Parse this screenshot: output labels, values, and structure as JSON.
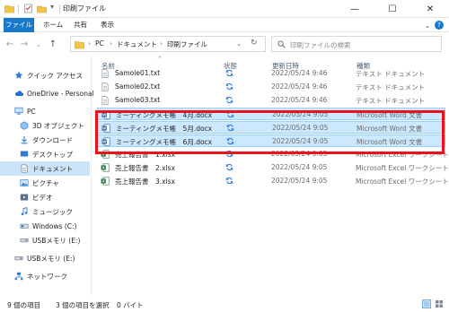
{
  "window": {
    "title": "印刷ファイル",
    "minimize": "—",
    "maximize": "☐",
    "close": "✕"
  },
  "ribbon": {
    "tabs": [
      "ファイル",
      "ホーム",
      "共有",
      "表示"
    ],
    "collapse": "⌄",
    "help": "?"
  },
  "address": {
    "back": "←",
    "forward": "→",
    "recent": "⌄",
    "up": "↑",
    "path": [
      "PC",
      "ドキュメント",
      "印刷ファイル"
    ],
    "separator": "›",
    "dropdown": "⌄",
    "refresh": "↻"
  },
  "search": {
    "placeholder": "印刷ファイルの検索"
  },
  "nav": {
    "items": [
      {
        "label": "クイック アクセス",
        "icon": "star-icon"
      },
      {
        "label": "OneDrive - Personal",
        "icon": "cloud-icon"
      },
      {
        "label": "PC",
        "icon": "computer-icon"
      },
      {
        "label": "3D オブジェクト",
        "icon": "3d-objects-icon"
      },
      {
        "label": "ダウンロード",
        "icon": "download-icon"
      },
      {
        "label": "デスクトップ",
        "icon": "desktop-icon"
      },
      {
        "label": "ドキュメント",
        "icon": "documents-icon"
      },
      {
        "label": "ピクチャ",
        "icon": "pictures-icon"
      },
      {
        "label": "ビデオ",
        "icon": "videos-icon"
      },
      {
        "label": "ミュージック",
        "icon": "music-icon"
      },
      {
        "label": "Windows (C:)",
        "icon": "drive-icon"
      },
      {
        "label": "USBメモリ (E:)",
        "icon": "usb-drive-icon"
      },
      {
        "label": "USBメモリ (E:)",
        "icon": "usb-drive-icon"
      },
      {
        "label": "ネットワーク",
        "icon": "network-icon"
      }
    ]
  },
  "columns": {
    "name": "名前",
    "status": "状態",
    "date": "更新日時",
    "type": "種類"
  },
  "files": [
    {
      "name": "Samole01.txt",
      "status": "sync",
      "date": "2022/05/24 9:46",
      "type": "テキスト ドキュメント",
      "kind": "txt",
      "selected": false
    },
    {
      "name": "Samole02.txt",
      "status": "sync",
      "date": "2022/05/24 9:46",
      "type": "テキスト ドキュメント",
      "kind": "txt",
      "selected": false
    },
    {
      "name": "Samole03.txt",
      "status": "sync",
      "date": "2022/05/24 9:46",
      "type": "テキスト ドキュメント",
      "kind": "txt",
      "selected": false
    },
    {
      "name": "ミーティングメモ帳　4月.docx",
      "status": "sync",
      "date": "2022/05/24 9:05",
      "type": "Microsoft Word 文書",
      "kind": "word",
      "selected": true
    },
    {
      "name": "ミーティングメモ帳　5月.docx",
      "status": "sync",
      "date": "2022/05/24 9:05",
      "type": "Microsoft Word 文書",
      "kind": "word",
      "selected": true
    },
    {
      "name": "ミーティングメモ帳　6月.docx",
      "status": "sync",
      "date": "2022/05/24 9:05",
      "type": "Microsoft Word 文書",
      "kind": "word",
      "selected": true
    },
    {
      "name": "売上報告書　1.xlsx",
      "status": "sync",
      "date": "2022/05/24 9:05",
      "type": "Microsoft Excel ワークシート",
      "kind": "excel",
      "selected": false
    },
    {
      "name": "売上報告書　2.xlsx",
      "status": "sync",
      "date": "2022/05/24 9:05",
      "type": "Microsoft Excel ワークシート",
      "kind": "excel",
      "selected": false
    },
    {
      "name": "売上報告書　3.xlsx",
      "status": "sync",
      "date": "2022/05/24 9:05",
      "type": "Microsoft Excel ワークシート",
      "kind": "excel",
      "selected": false
    }
  ],
  "status": {
    "items": "9 個の項目",
    "selected": "3 個の項目を選択",
    "size": "0 バイト"
  },
  "colors": {
    "accent": "#1979ca",
    "selection": "#cce8ff",
    "highlight": "#e8141c",
    "word": "#2b579a",
    "excel": "#217346",
    "sync": "#1e6fd9",
    "folder": "#f3c543"
  }
}
